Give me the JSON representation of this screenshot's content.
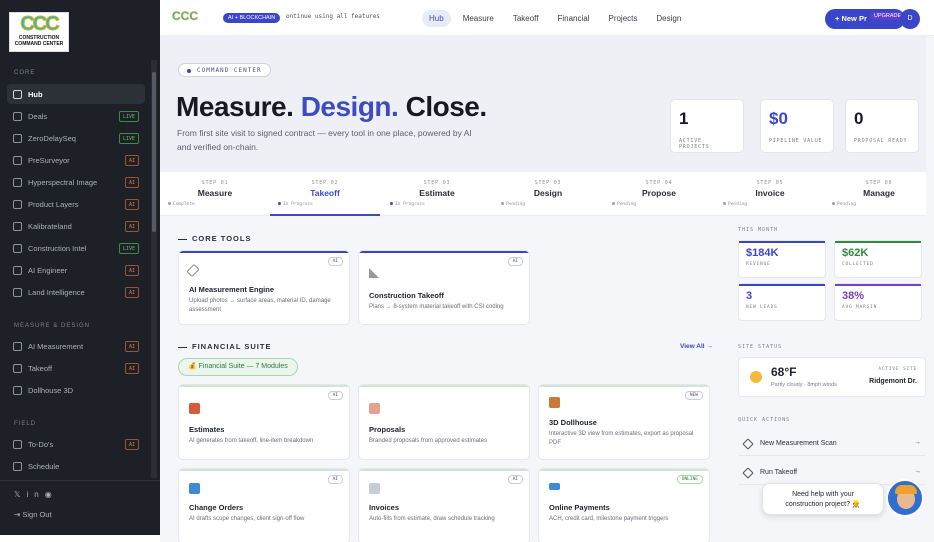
{
  "logo": {
    "mark": "CCC",
    "sub": "CONSTRUCTION COMMAND CENTER"
  },
  "sidebar": {
    "sections": [
      "CORE",
      "MEASURE & DESIGN",
      "FIELD"
    ],
    "items": [
      {
        "label": "Hub",
        "badge": ""
      },
      {
        "label": "Deals",
        "badge": "LIVE"
      },
      {
        "label": "ZeroDelaySeq",
        "badge": "LIVE"
      },
      {
        "label": "PreSurveyor",
        "badge": "AI"
      },
      {
        "label": "Hyperspectral Image",
        "badge": "AI"
      },
      {
        "label": "Product Layers",
        "badge": "AI"
      },
      {
        "label": "Kalibrateland",
        "badge": "AI"
      },
      {
        "label": "Construction Intel",
        "badge": "LIVE"
      },
      {
        "label": "AI Engineer",
        "badge": "AI"
      },
      {
        "label": "Land Intelligence",
        "badge": "AI"
      },
      {
        "label": "AI Measurement",
        "badge": "AI"
      },
      {
        "label": "Takeoff",
        "badge": "AI"
      },
      {
        "label": "Dollhouse 3D",
        "badge": ""
      },
      {
        "label": "To-Do's",
        "badge": "AI"
      },
      {
        "label": "Schedule",
        "badge": ""
      }
    ],
    "signout": "Sign Out"
  },
  "topbar": {
    "logo": "CCC",
    "chip": "AI + BLOCKCHAIN",
    "ticker": "ontinue using all features",
    "tabs": [
      "Hub",
      "Measure",
      "Takeoff",
      "Financial",
      "Projects",
      "Design"
    ],
    "new_button": "+ New Pr",
    "upgrade": "UPGRADE",
    "avatar": "D"
  },
  "hero": {
    "chip": "COMMAND CENTER",
    "title_a": "Measure.",
    "title_b": "Design.",
    "title_c": "Close.",
    "subtitle": "From first site visit to signed contract — every tool in one place, powered by AI and verified on-chain.",
    "stats": [
      {
        "value": "1",
        "label": "ACTIVE PROJECTS"
      },
      {
        "value": "$0",
        "label": "PIPELINE VALUE"
      },
      {
        "value": "0",
        "label": "PROPOSAL READY"
      }
    ]
  },
  "steps": [
    {
      "num": "STEP 01",
      "title": "Measure",
      "status": "Complete"
    },
    {
      "num": "STEP 02",
      "title": "Takeoff",
      "status": "In Progress"
    },
    {
      "num": "STEP 03",
      "title": "Estimate",
      "status": "In Progress"
    },
    {
      "num": "STEP 03",
      "title": "Design",
      "status": "Pending"
    },
    {
      "num": "STEP 04",
      "title": "Propose",
      "status": "Pending"
    },
    {
      "num": "STEP 05",
      "title": "Invoice",
      "status": "Pending"
    },
    {
      "num": "STEP 06",
      "title": "Manage",
      "status": "Pending"
    }
  ],
  "core_tools": {
    "title": "CORE TOOLS",
    "cards": [
      {
        "tag": "AI",
        "title": "AI Measurement Engine",
        "desc": "Upload photos → surface areas, material ID, damage assessment"
      },
      {
        "tag": "AI",
        "title": "Construction Takeoff",
        "desc": "Plans → 8-system material takeoff with CSI coding"
      }
    ]
  },
  "financial": {
    "title": "FINANCIAL SUITE",
    "view_all": "View All →",
    "pill": "💰 Financial Suite — 7 Modules",
    "cards": [
      {
        "tag": "AI",
        "title": "Estimates",
        "desc": "AI generates from takeoff, line-item breakdown"
      },
      {
        "tag": "",
        "title": "Proposals",
        "desc": "Branded proposals from approved estimates"
      },
      {
        "tag": "NEW",
        "title": "3D Dollhouse",
        "desc": "Interactive 3D view from estimates, export as proposal PDF"
      },
      {
        "tag": "AI",
        "title": "Change Orders",
        "desc": "AI drafts scope changes, client sign-off flow"
      },
      {
        "tag": "AI",
        "title": "Invoices",
        "desc": "Auto-fills from estimate, draw schedule tracking"
      },
      {
        "tag": "ONLINE",
        "title": "Online Payments",
        "desc": "ACH, credit card, milestone payment triggers"
      }
    ]
  },
  "right": {
    "this_month": "THIS MONTH",
    "metrics": [
      {
        "value": "$184K",
        "label": "REVENUE",
        "color": "#3a46c8"
      },
      {
        "value": "$62K",
        "label": "COLLECTED",
        "color": "#2f8a3f"
      },
      {
        "value": "3",
        "label": "NEW LEADS",
        "color": "#3a46c8"
      },
      {
        "value": "38%",
        "label": "AVG MARGIN",
        "color": "#7a3fc8"
      }
    ],
    "site_status": "SITE STATUS",
    "weather": {
      "temp": "68°F",
      "desc": "Partly cloudy · 8mph winds",
      "active_label": "ACTIVE SITE",
      "active_site": "Ridgemont Dr."
    },
    "quick_actions": "QUICK ACTIONS",
    "actions": [
      {
        "label": "New Measurement Scan",
        "arrow": "→"
      },
      {
        "label": "Run Takeoff",
        "arrow": "→"
      }
    ]
  },
  "help": {
    "line1": "Need help with your",
    "line2": "construction project? 👷"
  },
  "colors": {
    "accent": "#3a46c8",
    "sidebar": "#1d2027",
    "live": "#5fbf6a",
    "ai": "#e07a45"
  }
}
